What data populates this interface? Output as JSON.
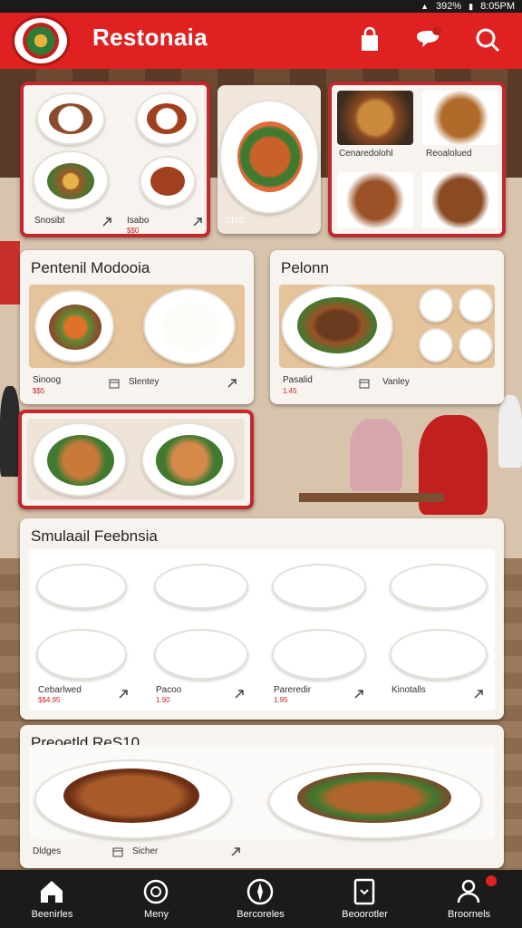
{
  "statusbar": {
    "signal": "392%",
    "time": "8:05PM"
  },
  "header": {
    "title": "Restonaia"
  },
  "colors": {
    "brand": "#e02121",
    "accent": "#c3282c",
    "nav_bg": "#1b1b1b"
  },
  "icons": [
    "logo",
    "shopping-bag-icon",
    "chat-icon",
    "search-icon",
    "home-icon",
    "menu-icon",
    "compass-icon",
    "bookmark-icon",
    "profile-icon"
  ],
  "top_cards": [
    {
      "labels": [
        {
          "title": "Snosibt",
          "sub": ""
        },
        {
          "title": "Isabo",
          "sub": "$$0"
        }
      ]
    },
    {
      "labels": [
        {
          "title": "0105",
          "sub": ""
        }
      ]
    },
    {
      "labels": [
        {
          "title": "Cenaredolohl",
          "sub": ""
        },
        {
          "title": "Reoalolued",
          "sub": ""
        }
      ]
    }
  ],
  "section1": {
    "title": "Pentenil Modooia",
    "left_caption": "Sinoog",
    "left_sub": "$$5",
    "right_caption": "Slentey"
  },
  "section2": {
    "title": "Pelonn",
    "left_caption": "Pasalid",
    "left_sub": "1.45",
    "right_caption": "Vanley"
  },
  "section3": {
    "title": "Smulaail Feebnsia",
    "items": [
      {
        "name": "Cebarlwed",
        "sub": "$$4.95"
      },
      {
        "name": "Pacoo",
        "sub": "1.90"
      },
      {
        "name": "Pareredir",
        "sub": "1.95"
      },
      {
        "name": "Kinotalls",
        "sub": ""
      }
    ]
  },
  "section4": {
    "title": "Preoetld ReS10",
    "left_caption": "Dldges",
    "right_caption": "Sicher"
  },
  "nav": [
    {
      "label": "Beenirles",
      "active": true
    },
    {
      "label": "Meny"
    },
    {
      "label": "Bercoreles"
    },
    {
      "label": "Beoorotler"
    },
    {
      "label": "Broornels"
    }
  ]
}
